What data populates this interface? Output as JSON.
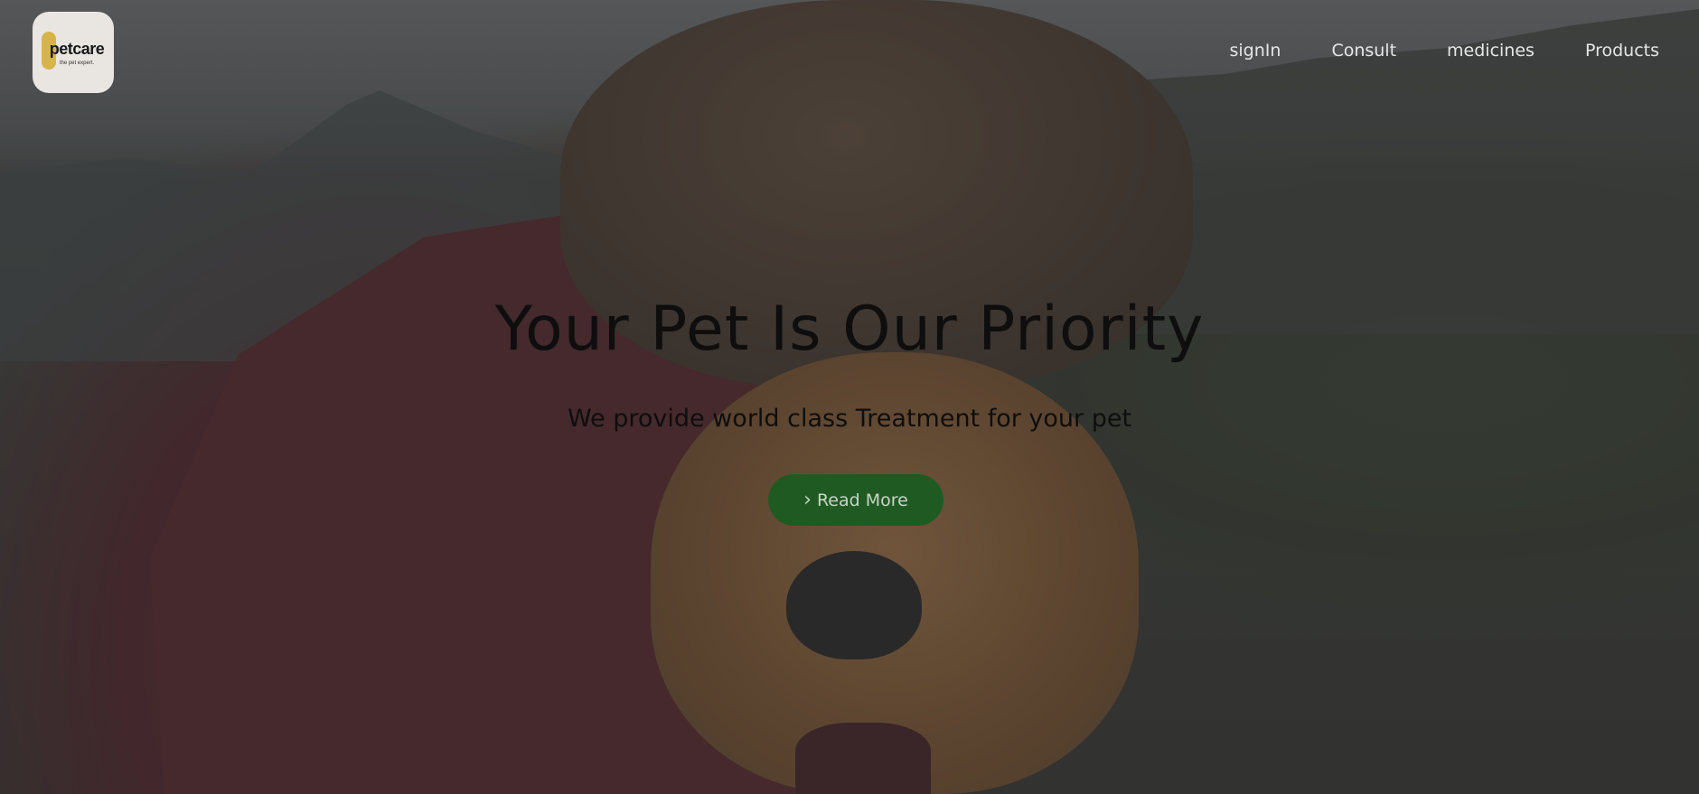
{
  "logo": {
    "name": "petcare",
    "tagline": "the pet expert."
  },
  "nav": {
    "items": [
      {
        "label": "signIn"
      },
      {
        "label": "Consult"
      },
      {
        "label": "medicines"
      },
      {
        "label": "Products"
      }
    ]
  },
  "hero": {
    "title": "Your Pet Is Our Priority",
    "subtitle": "We provide world class Treatment for your pet",
    "button_label": "Read More",
    "button_icon": "chevron-right-icon"
  },
  "colors": {
    "button_bg": "#1f5a23",
    "nav_text": "#e6e6e6",
    "hero_text": "#0e0e0e",
    "logo_bg": "#e9e6e2",
    "logo_accent": "#d7b44a"
  }
}
